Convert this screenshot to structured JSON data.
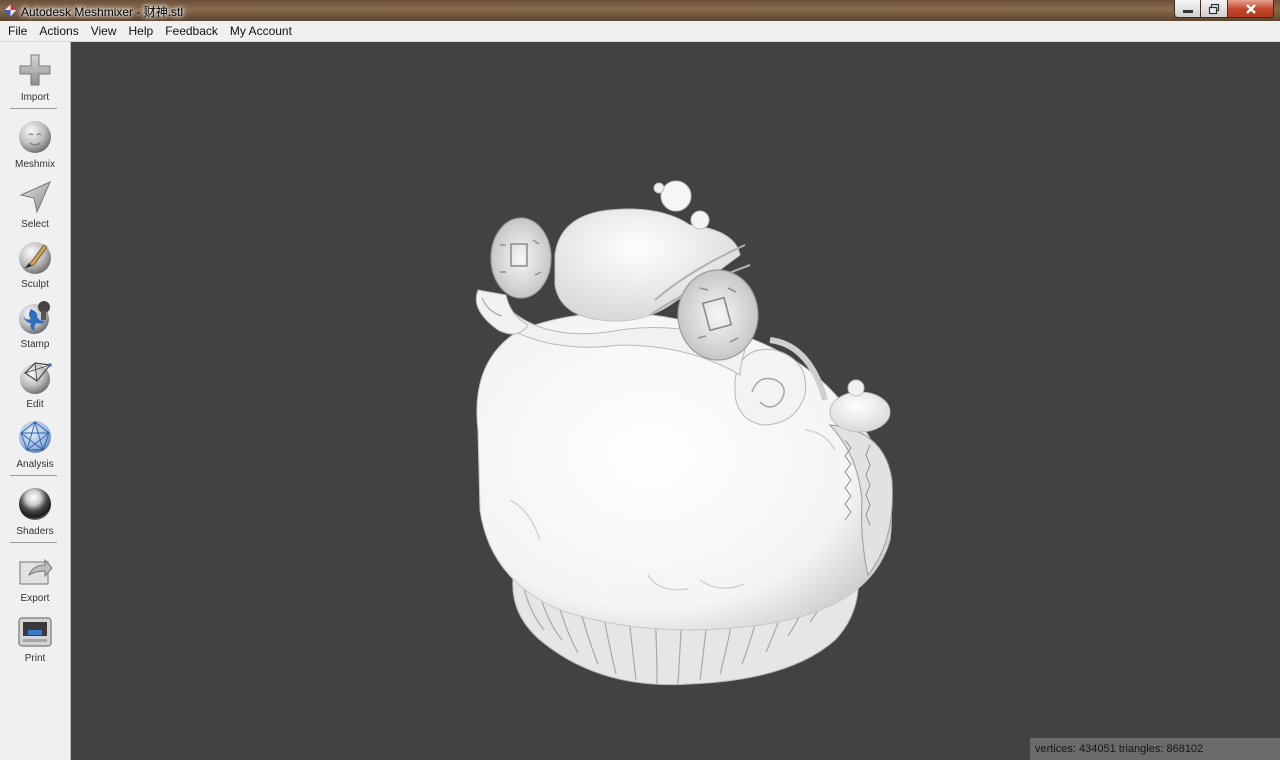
{
  "window": {
    "title": "Autodesk Meshmixer - 财神.stl"
  },
  "menu": [
    "File",
    "Actions",
    "View",
    "Help",
    "Feedback",
    "My Account"
  ],
  "tools": [
    {
      "label": "Import",
      "icon": "plus-icon"
    },
    {
      "label": "Meshmix",
      "icon": "meshmix-ball-icon"
    },
    {
      "label": "Select",
      "icon": "select-arrow-icon"
    },
    {
      "label": "Sculpt",
      "icon": "sculpt-brush-icon"
    },
    {
      "label": "Stamp",
      "icon": "stamp-icon"
    },
    {
      "label": "Edit",
      "icon": "edit-icon"
    },
    {
      "label": "Analysis",
      "icon": "analysis-icon"
    },
    {
      "label": "Shaders",
      "icon": "shader-sphere-icon"
    },
    {
      "label": "Export",
      "icon": "export-icon"
    },
    {
      "label": "Print",
      "icon": "printer-icon"
    }
  ],
  "status": {
    "text": "vertices: 434051 triangles: 868102"
  },
  "colors": {
    "viewport": "#434240",
    "toolbar": "#f0f0f0",
    "status_bg": "#6b6b6b",
    "accent_blue": "#3a78c8"
  }
}
